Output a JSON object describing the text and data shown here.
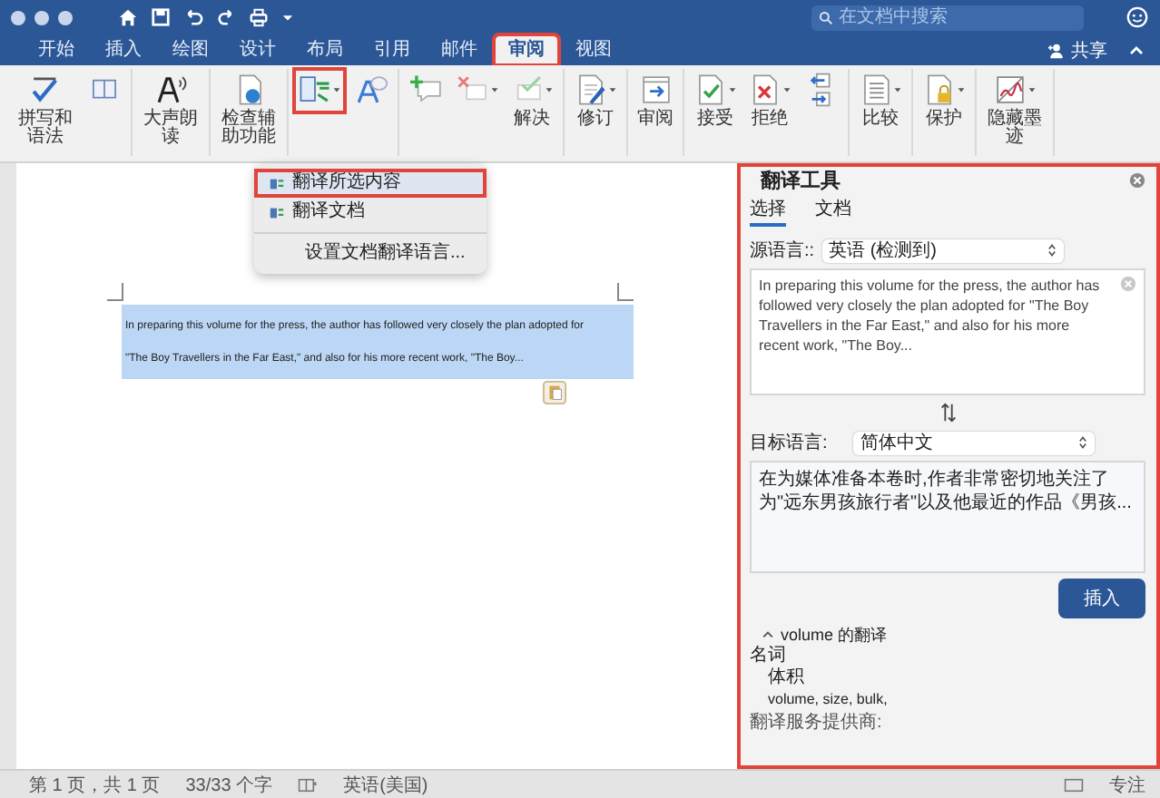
{
  "title_bar": {
    "search": {
      "placeholder": "在文档中搜索"
    }
  },
  "tabs": [
    {
      "label": "开始",
      "selected": false
    },
    {
      "label": "插入",
      "selected": false
    },
    {
      "label": "绘图",
      "selected": false
    },
    {
      "label": "设计",
      "selected": false
    },
    {
      "label": "布局",
      "selected": false
    },
    {
      "label": "引用",
      "selected": false
    },
    {
      "label": "邮件",
      "selected": false
    },
    {
      "label": "审阅",
      "selected": true
    },
    {
      "label": "视图",
      "selected": false
    }
  ],
  "share": {
    "label": "共享"
  },
  "ribbon": {
    "groups": [
      {
        "items": [
          {
            "kind": "spell",
            "label": "拼写和语法",
            "dropdown": false
          },
          {
            "kind": "doc",
            "dropdown": false
          }
        ]
      },
      {
        "items": [
          {
            "kind": "read",
            "label": "大声朗读",
            "dropdown": false
          }
        ]
      },
      {
        "items": [
          {
            "kind": "check",
            "label": "检查辅助功能",
            "dropdown": false
          }
        ]
      },
      {
        "items": [
          {
            "kind": "translate",
            "dropdown": true
          },
          {
            "kind": "font",
            "dropdown": false
          }
        ]
      },
      {
        "items": [
          {
            "kind": "comment",
            "dropdown": false
          },
          {
            "kind": "delete",
            "dropdown": true
          },
          {
            "kind": "resolve",
            "label": "解决",
            "dropdown": true
          }
        ]
      },
      {
        "items": [
          {
            "kind": "track",
            "label": "修订",
            "dropdown": true
          }
        ]
      },
      {
        "items": [
          {
            "kind": "review",
            "label": "审阅",
            "dropdown": false
          }
        ]
      },
      {
        "items": [
          {
            "kind": "accept",
            "label": "接受",
            "dropdown": true
          },
          {
            "kind": "reject",
            "label": "拒绝",
            "dropdown": true
          },
          {
            "kind": "arrows",
            "dropdown": false
          }
        ]
      },
      {
        "items": [
          {
            "kind": "compare",
            "label": "比较",
            "dropdown": true
          }
        ]
      },
      {
        "items": [
          {
            "kind": "protect",
            "label": "保护",
            "dropdown": true
          }
        ]
      },
      {
        "items": [
          {
            "kind": "ink",
            "label": "隐藏墨迹",
            "dropdown": true
          }
        ]
      }
    ]
  },
  "translate_menu": {
    "items": [
      {
        "label": "翻译所选内容",
        "selected": true
      },
      {
        "label": "翻译文档",
        "selected": false
      },
      {
        "label": "设置文档翻译语言...",
        "selected": false
      }
    ]
  },
  "document": {
    "lines": [
      "In preparing this volume for the press, the author has followed very closely the plan adopted for",
      "\"The Boy Travellers in the Far East,\" and also for his more recent work, \"The Boy..."
    ]
  },
  "translator_panel": {
    "title": "翻译工具",
    "tabs": [
      {
        "label": "选择",
        "selected": true
      },
      {
        "label": "文档",
        "selected": false
      }
    ],
    "source_label": "源语言::",
    "source_language": "英语 (检测到)",
    "source_text": "In preparing this volume for the press, the author has followed very closely the plan adopted for \"The Boy Travellers in the Far East,\" and also for his more recent work, \"The Boy...",
    "target_label": "目标语言:",
    "target_language": "简体中文",
    "target_text": "在为媒体准备本卷时,作者非常密切地关注了为\"远东男孩旅行者\"以及他最近的作品《男孩...",
    "insert_button": "插入",
    "dictionary_header": "volume 的翻译",
    "part_of_speech": "名词",
    "headword": "体积",
    "synonyms": "volume, size, bulk,",
    "provider": "翻译服务提供商:"
  },
  "status_bar": {
    "page": "第 1 页，共 1 页",
    "words": "33/33 个字",
    "language": "英语(美国)",
    "focus": "专注"
  }
}
